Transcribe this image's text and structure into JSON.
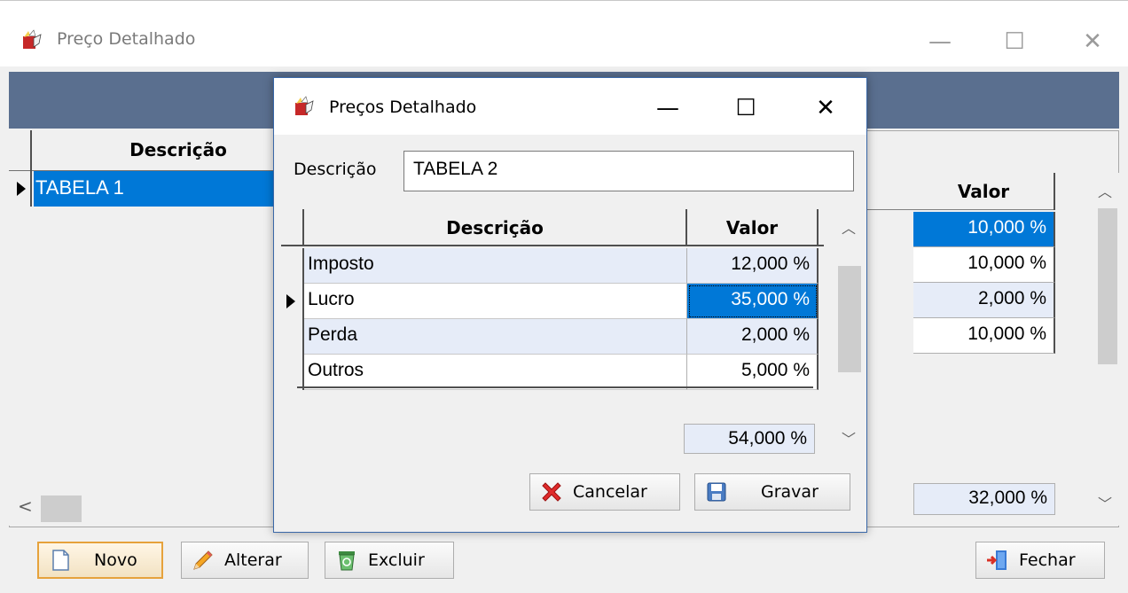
{
  "main_window": {
    "title": "Preço Detalhado",
    "left_grid": {
      "column_header": "Descrição",
      "rows": [
        "TABELA 1"
      ]
    },
    "right_grid": {
      "column_header": "Valor",
      "values": [
        "10,000 %",
        "10,000 %",
        "2,000 %",
        "10,000 %"
      ],
      "total": "32,000 %"
    },
    "toolbar": {
      "novo_label": "Novo",
      "alterar_label": "Alterar",
      "excluir_label": "Excluir",
      "fechar_label": "Fechar"
    }
  },
  "dialog": {
    "title": "Preços Detalhado",
    "descricao_label": "Descrição",
    "descricao_value": "TABELA 2",
    "grid": {
      "headers": [
        "Descrição",
        "Valor"
      ],
      "rows": [
        {
          "descricao": "Imposto",
          "valor": "12,000 %"
        },
        {
          "descricao": "Lucro",
          "valor": "35,000 %"
        },
        {
          "descricao": "Perda",
          "valor": "2,000 %"
        },
        {
          "descricao": "Outros",
          "valor": "5,000 %"
        }
      ],
      "total": "54,000 %"
    },
    "cancelar_label": "Cancelar",
    "gravar_label": "Gravar"
  },
  "colors": {
    "selection": "#0078d7",
    "band": "#5a6f8f",
    "alt_row": "#e6ecf8"
  },
  "icons": [
    "app-icon",
    "minimize-icon",
    "maximize-icon",
    "close-icon",
    "new-doc-icon",
    "pencil-icon",
    "recycle-bin-icon",
    "exit-door-icon",
    "cancel-x-icon",
    "floppy-disk-icon",
    "row-pointer-icon"
  ]
}
